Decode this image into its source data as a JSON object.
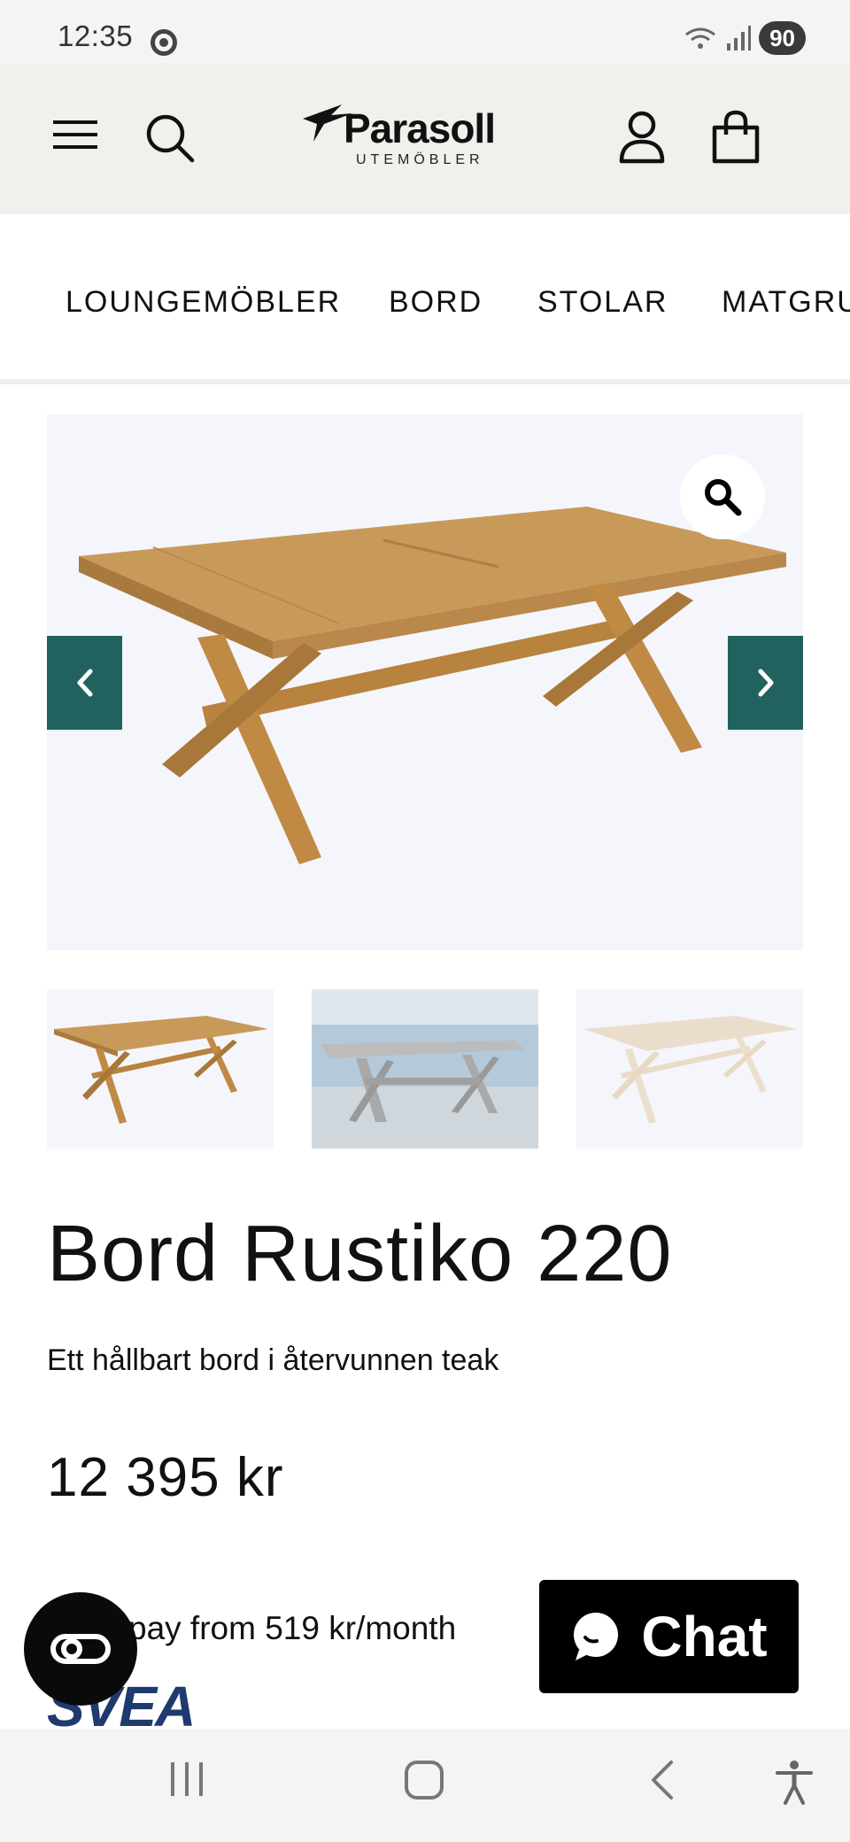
{
  "status_bar": {
    "time": "12:35",
    "battery": "90",
    "icons": [
      "wifi-icon",
      "signal-icon",
      "battery-icon"
    ]
  },
  "header": {
    "logo_text": "Parasoll",
    "logo_subtitle": "UTEMÖBLER",
    "icons": [
      "menu-icon",
      "search-icon",
      "account-icon",
      "cart-icon"
    ]
  },
  "nav": {
    "items": [
      {
        "label": "LOUNGEMÖBLER"
      },
      {
        "label": "BORD"
      },
      {
        "label": "STOLAR"
      },
      {
        "label": "MATGRU"
      }
    ]
  },
  "gallery": {
    "icons": [
      "zoom-icon",
      "chevron-left-icon",
      "chevron-right-icon"
    ],
    "thumbnail_count": 3
  },
  "product": {
    "title": "Bord Rustiko 220",
    "subtitle": "Ett hållbart bord i återvunnen teak",
    "price": "12 395 kr",
    "installment": "pay from 519 kr/month",
    "financing_logo": "SVEA"
  },
  "chat": {
    "label": "Chat"
  },
  "colors": {
    "header_bg": "#f1f0ec",
    "accent": "#22625e",
    "svea_blue": "#1f3a6e"
  }
}
